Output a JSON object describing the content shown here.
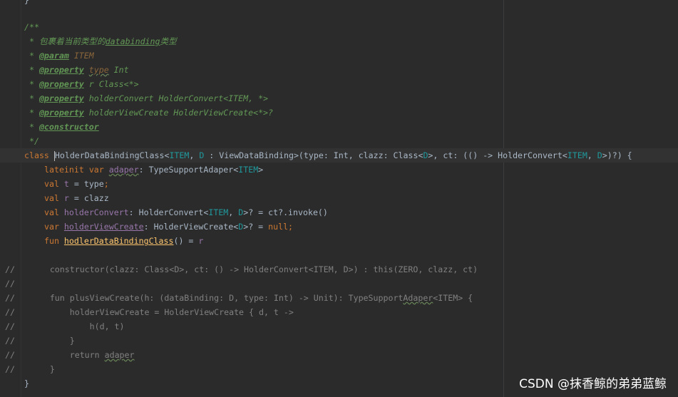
{
  "code": {
    "l0": "}",
    "l1": "/**",
    "l2_a": " * 包裹着当前类型的",
    "l2_b": "databinding",
    "l2_c": "类型",
    "l3_tag": "@param",
    "l3_rest": " ITEM",
    "l4_tag": "@property",
    "l4_a": " ",
    "l4_b": "type",
    "l4_c": " Int",
    "l5_tag": "@property",
    "l5_rest": " r Class<*>",
    "l6_tag": "@property",
    "l6_rest": " holderConvert HolderConvert<ITEM, *>",
    "l7_tag": "@property",
    "l7_rest": " holderViewCreate HolderViewCreate<*>?",
    "l8_tag": "@constructor",
    "l9": "*/",
    "l10_class": "class ",
    "l10_name": "HolderDataBindingClass",
    "l10_a": "<",
    "l10_item": "ITEM",
    "l10_b": ", ",
    "l10_d": "D",
    "l10_c": " : ViewDataBinding>(type: Int, clazz: Class<",
    "l10_d2": "D",
    "l10_e": ">, ct: (() -> HolderConvert<",
    "l10_item2": "ITEM",
    "l10_f": ", ",
    "l10_d3": "D",
    "l10_g": ">)?) {",
    "l11_kw": "lateinit var ",
    "l11_name": "adaper",
    "l11_a": ": TypeSupportAdaper<",
    "l11_item": "ITEM",
    "l11_b": ">",
    "l12_kw": "val ",
    "l12_name": "t",
    "l12_rest": " = type",
    "l12_semi": ";",
    "l13_kw": "val ",
    "l13_name": "r",
    "l13_rest": " = clazz",
    "l14_kw": "val ",
    "l14_name": "holderConvert",
    "l14_a": ": HolderConvert<",
    "l14_item": "ITEM",
    "l14_b": ", ",
    "l14_d": "D",
    "l14_c": ">? = ct?.invoke()",
    "l15_kw": "var ",
    "l15_name": "holderViewCreate",
    "l15_a": ": HolderViewCreate<",
    "l15_d": "D",
    "l15_b": ">? = ",
    "l15_null": "null",
    "l15_semi": ";",
    "l16_kw": "fun ",
    "l16_name": "hodlerDataBindingClass",
    "l16_a": "() = ",
    "l16_r": "r",
    "l18": "//       constructor(clazz: Class<D>, ct: () -> HolderConvert<ITEM, D>) : this(ZERO, clazz, ct)",
    "l19": "//",
    "l20_a": "//       fun plusViewCreate(h: (dataBinding: D, type: Int) -> Unit): TypeSupport",
    "l20_b": "Adaper",
    "l20_c": "<ITEM> {",
    "l21": "//           holderViewCreate = HolderViewCreate { d, t ->",
    "l22": "//               h(d, t)",
    "l23": "//           }",
    "l24_a": "//           return ",
    "l24_b": "adaper",
    "l25": "//       }",
    "l26": "}"
  },
  "watermark": "CSDN @抹香鲸的弟弟蓝鲸"
}
